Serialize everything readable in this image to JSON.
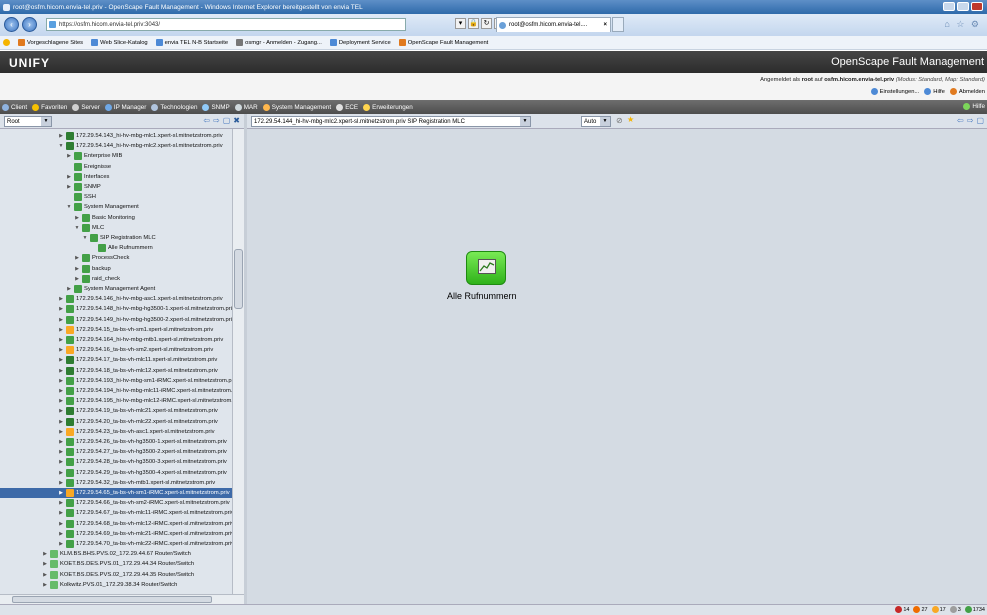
{
  "browser": {
    "window_title": "root@osfm.hicom.envia-tel.priv - OpenScape Fault Management - Windows Internet Explorer bereitgestellt von envia TEL",
    "url": "https://osfm.hicom.envia-tel.priv:3043/",
    "tab_title": "root@osfm.hicom.envia-tel....",
    "favorites": [
      "Vorgeschlagene Sites",
      "Web Slice-Katalog",
      "envia TEL N-B Startseite",
      "osmgr - Anmelden - Zugang...",
      "Deployment Service",
      "OpenScape Fault Management"
    ]
  },
  "app": {
    "logo": "UNIFY",
    "title": "OpenScape Fault Management",
    "login_prefix": "Angemeldet als ",
    "user": "root",
    "login_mid": " auf ",
    "host": "osfm.hicom.envia-tel.priv",
    "login_suffix": " (Modus: Standard, Map: Standard)",
    "links": [
      "Einstellungen...",
      "Hilfe",
      "Abmelden"
    ]
  },
  "menu": [
    "Client",
    "Favoriten",
    "Server",
    "IP Manager",
    "Technologien",
    "SNMP",
    "MAR",
    "System Management",
    "ECE",
    "Erweiterungen"
  ],
  "menu_right": "Hilfe",
  "left_toolbar": {
    "root_select": "Root"
  },
  "right_toolbar": {
    "path_select": "172.29.54.144_hi-hv-mbg-mlc2.xpert-sl.mitnetzstrom.priv SIP Registration MLC",
    "mode_select": "Auto"
  },
  "tree": [
    {
      "label": "172.29.54.143_hi-hv-mbg-mlc1.xpert-sl.mitnetzstrom.priv",
      "depth": 4,
      "toggle": "▶",
      "icon": "#2e7d32"
    },
    {
      "label": "172.29.54.144_hi-hv-mbg-mlc2.xpert-sl.mitnetzstrom.priv",
      "depth": 4,
      "toggle": "▼",
      "icon": "#2e7d32"
    },
    {
      "label": "Enterprise MIB",
      "depth": 5,
      "toggle": "▶",
      "icon": "#43a047"
    },
    {
      "label": "Ereignisse",
      "depth": 5,
      "toggle": "",
      "icon": "#43a047"
    },
    {
      "label": "Interfaces",
      "depth": 5,
      "toggle": "▶",
      "icon": "#43a047"
    },
    {
      "label": "SNMP",
      "depth": 5,
      "toggle": "▶",
      "icon": "#43a047"
    },
    {
      "label": "SSH",
      "depth": 5,
      "toggle": "",
      "icon": "#43a047"
    },
    {
      "label": "System Management",
      "depth": 5,
      "toggle": "▼",
      "icon": "#43a047"
    },
    {
      "label": "Basic Monitoring",
      "depth": 6,
      "toggle": "▶",
      "icon": "#43a047"
    },
    {
      "label": "MLC",
      "depth": 6,
      "toggle": "▼",
      "icon": "#43a047"
    },
    {
      "label": "SIP Registration MLC",
      "depth": 7,
      "toggle": "▼",
      "icon": "#43a047"
    },
    {
      "label": "Alle Rufnummern",
      "depth": 8,
      "toggle": "",
      "icon": "#43a047"
    },
    {
      "label": "ProcessCheck",
      "depth": 6,
      "toggle": "▶",
      "icon": "#43a047"
    },
    {
      "label": "backup",
      "depth": 6,
      "toggle": "▶",
      "icon": "#43a047"
    },
    {
      "label": "raid_check",
      "depth": 6,
      "toggle": "▶",
      "icon": "#43a047"
    },
    {
      "label": "System Management Agent",
      "depth": 5,
      "toggle": "▶",
      "icon": "#43a047"
    },
    {
      "label": "172.29.54.146_hi-hv-mbg-asc1.xpert-sl.mitnetzstrom.priv",
      "depth": 4,
      "toggle": "▶",
      "icon": "#43a047"
    },
    {
      "label": "172.29.54.148_hi-hv-mbg-hg3500-1.xpert-sl.mitnetzstrom.priv",
      "depth": 4,
      "toggle": "▶",
      "icon": "#43a047"
    },
    {
      "label": "172.29.54.149_hi-hv-mbg-hg3500-2.xpert-sl.mitnetzstrom.priv",
      "depth": 4,
      "toggle": "▶",
      "icon": "#43a047"
    },
    {
      "label": "172.29.54.15_ta-bs-vh-sm1.xpert-sl.mitnetzstrom.priv",
      "depth": 4,
      "toggle": "▶",
      "icon": "#f9a825"
    },
    {
      "label": "172.29.54.164_hi-hv-mbg-mtb1.xpert-sl.mitnetzstrom.priv",
      "depth": 4,
      "toggle": "▶",
      "icon": "#43a047"
    },
    {
      "label": "172.29.54.16_ta-bs-vh-sm2.xpert-sl.mitnetzstrom.priv",
      "depth": 4,
      "toggle": "▶",
      "icon": "#f9a825"
    },
    {
      "label": "172.29.54.17_ta-bs-vh-mlc11.xpert-sl.mitnetzstrom.priv",
      "depth": 4,
      "toggle": "▶",
      "icon": "#2e7d32"
    },
    {
      "label": "172.29.54.18_ta-bs-vh-mlc12.xpert-sl.mitnetzstrom.priv",
      "depth": 4,
      "toggle": "▶",
      "icon": "#2e7d32"
    },
    {
      "label": "172.29.54.193_hi-hv-mbg-sm1-iRMC.xpert-sl.mitnetzstrom.priv",
      "depth": 4,
      "toggle": "▶",
      "icon": "#43a047"
    },
    {
      "label": "172.29.54.194_hi-hv-mbg-mlc11-iRMC.xpert-sl.mitnetzstrom.priv",
      "depth": 4,
      "toggle": "▶",
      "icon": "#43a047"
    },
    {
      "label": "172.29.54.195_hi-hv-mbg-mlc12-iRMC.xpert-sl.mitnetzstrom.priv",
      "depth": 4,
      "toggle": "▶",
      "icon": "#43a047"
    },
    {
      "label": "172.29.54.19_ta-bs-vh-mlc21.xpert-sl.mitnetzstrom.priv",
      "depth": 4,
      "toggle": "▶",
      "icon": "#2e7d32"
    },
    {
      "label": "172.29.54.20_ta-bs-vh-mlc22.xpert-sl.mitnetzstrom.priv",
      "depth": 4,
      "toggle": "▶",
      "icon": "#2e7d32"
    },
    {
      "label": "172.29.54.23_ta-bs-vh-asc1.xpert-sl.mitnetzstrom.priv",
      "depth": 4,
      "toggle": "▶",
      "icon": "#f9a825"
    },
    {
      "label": "172.29.54.26_ta-bs-vh-hg3500-1.xpert-sl.mitnetzstrom.priv",
      "depth": 4,
      "toggle": "▶",
      "icon": "#43a047"
    },
    {
      "label": "172.29.54.27_ta-bs-vh-hg3500-2.xpert-sl.mitnetzstrom.priv",
      "depth": 4,
      "toggle": "▶",
      "icon": "#43a047"
    },
    {
      "label": "172.29.54.28_ta-bs-vh-hg3500-3.xpert-sl.mitnetzstrom.priv",
      "depth": 4,
      "toggle": "▶",
      "icon": "#43a047"
    },
    {
      "label": "172.29.54.29_ta-bs-vh-hg3500-4.xpert-sl.mitnetzstrom.priv",
      "depth": 4,
      "toggle": "▶",
      "icon": "#43a047"
    },
    {
      "label": "172.29.54.32_ta-bs-vh-mtb1.xpert-sl.mitnetzstrom.priv",
      "depth": 4,
      "toggle": "▶",
      "icon": "#43a047"
    },
    {
      "label": "172.29.54.65_ta-bs-vh-sm1-iRMC.xpert-sl.mitnetzstrom.priv",
      "depth": 4,
      "toggle": "▶",
      "icon": "#f9a825",
      "selected": true
    },
    {
      "label": "172.29.54.66_ta-bs-vh-sm2-iRMC.xpert-sl.mitnetzstrom.priv",
      "depth": 4,
      "toggle": "▶",
      "icon": "#43a047"
    },
    {
      "label": "172.29.54.67_ta-bs-vh-mlc11-iRMC.xpert-sl.mitnetzstrom.priv",
      "depth": 4,
      "toggle": "▶",
      "icon": "#43a047"
    },
    {
      "label": "172.29.54.68_ta-bs-vh-mlc12-iRMC.xpert-sl.mitnetzstrom.priv",
      "depth": 4,
      "toggle": "▶",
      "icon": "#43a047"
    },
    {
      "label": "172.29.54.69_ta-bs-vh-mlc21-iRMC.xpert-sl.mitnetzstrom.priv",
      "depth": 4,
      "toggle": "▶",
      "icon": "#43a047"
    },
    {
      "label": "172.29.54.70_ta-bs-vh-mlc22-iRMC.xpert-sl.mitnetzstrom.priv",
      "depth": 4,
      "toggle": "▶",
      "icon": "#43a047"
    },
    {
      "label": "KLM.BS.BHS.PVS.02_172.29.44.67 Router/Switch",
      "depth": 2,
      "toggle": "▶",
      "icon": "#66bb6a"
    },
    {
      "label": "KOET.BS.DES.PVS.01_172.29.44.34 Router/Switch",
      "depth": 2,
      "toggle": "▶",
      "icon": "#66bb6a"
    },
    {
      "label": "KOET.BS.DES.PVS.02_172.29.44.35 Router/Switch",
      "depth": 2,
      "toggle": "▶",
      "icon": "#66bb6a"
    },
    {
      "label": "Kolkwitz.PVS.01_172.29.38.34 Router/Switch",
      "depth": 2,
      "toggle": "▶",
      "icon": "#66bb6a"
    }
  ],
  "canvas": {
    "node_label": "Alle Rufnummern"
  },
  "status_counts": [
    "14",
    "27",
    "17",
    "3",
    "1734"
  ],
  "colors": {
    "ok": "#43a047",
    "warning": "#f9a825",
    "critical": "#c62828",
    "selection": "#3d6aa8",
    "header": "#2c2c2c"
  }
}
